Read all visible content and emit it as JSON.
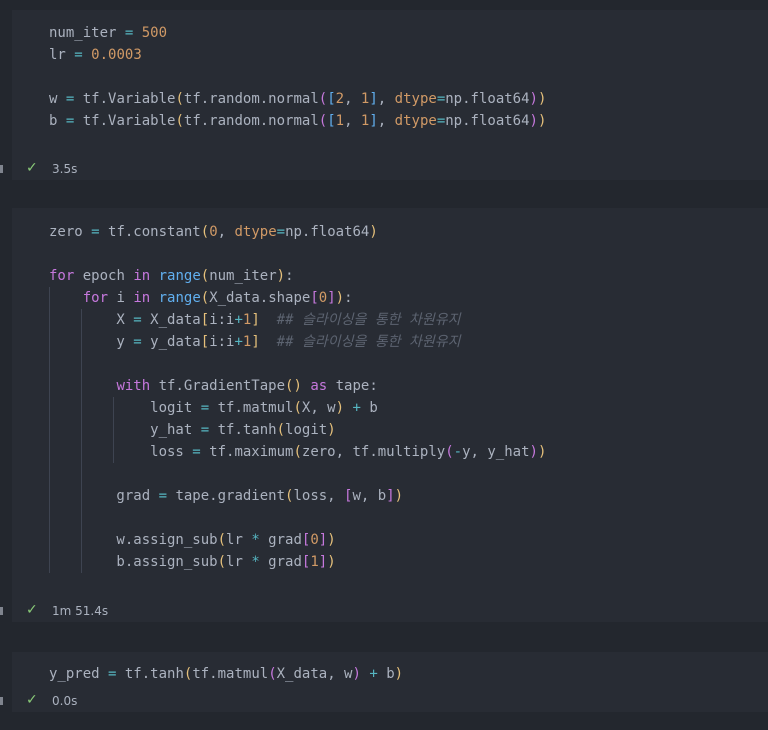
{
  "cells": [
    {
      "status": {
        "time": "3.5s"
      }
    },
    {
      "status": {
        "time": "1m 51.4s"
      },
      "comment": "## 슬라이싱을 통한 차원유지"
    },
    {
      "status": {
        "time": "0.0s"
      }
    }
  ],
  "colors": {
    "background": "#23272e",
    "cell_background": "#282c34",
    "keyword": "#c678dd",
    "number": "#d19a66",
    "operator": "#56b6c2",
    "bracket_1": "#e5c07b",
    "bracket_2": "#c678dd",
    "bracket_3": "#61afef",
    "success": "#89ca78"
  }
}
